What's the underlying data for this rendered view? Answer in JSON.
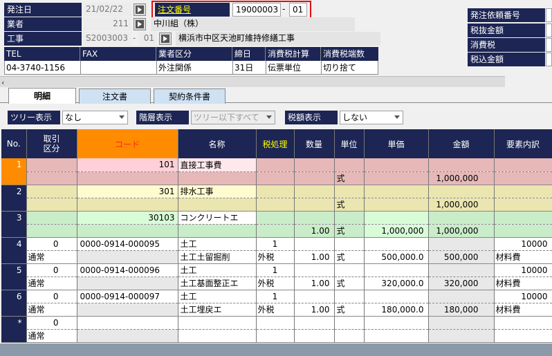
{
  "header": {
    "order_date_label": "発注日",
    "order_date": "21/02/22",
    "order_no_label": "注文番号",
    "order_no": "19000003",
    "order_sep": "-",
    "order_branch": "01",
    "vendor_label": "業者",
    "vendor_code": "211",
    "vendor_name": "中川組（株）",
    "project_label": "工事",
    "project_code": "S2003003",
    "project_sep": "-",
    "project_branch": "01",
    "project_name": "横浜市中区天池町維持修繕工事"
  },
  "info_table": {
    "headers": [
      "TEL",
      "FAX",
      "業者区分",
      "締日",
      "消費税計算",
      "消費税端数"
    ],
    "values": [
      "04-3740-1156",
      "",
      "外注関係",
      "31日",
      "伝票単位",
      "切り捨て"
    ]
  },
  "right_panel": {
    "labels": [
      "発注依頼番号",
      "税抜金額",
      "消費税",
      "税込金額"
    ]
  },
  "tabs": [
    "明細",
    "注文書",
    "契約条件書"
  ],
  "filters": {
    "tree_label": "ツリー表示",
    "tree_value": "なし",
    "level_label": "階層表示",
    "level_value": "ツリー以下すべて",
    "tax_label": "税額表示",
    "tax_value": "しない"
  },
  "grid": {
    "columns": [
      "No.",
      "取引\n区分",
      "コード",
      "名称",
      "税処理",
      "数量",
      "単位",
      "単価",
      "金額",
      "要素内訳"
    ],
    "rows": [
      {
        "no": "1",
        "a1": "",
        "a2": "",
        "code": "101",
        "name1": "直接工事費",
        "name2": "",
        "tax1": "",
        "tax2": "",
        "qty": "",
        "unit": "式",
        "price": "",
        "amount": "1,000,000",
        "el1": "",
        "el2": ""
      },
      {
        "no": "2",
        "a1": "",
        "a2": "",
        "code": "301",
        "name1": "排水工事",
        "name2": "",
        "tax1": "",
        "tax2": "",
        "qty": "",
        "unit": "式",
        "price": "",
        "amount": "1,000,000",
        "el1": "",
        "el2": ""
      },
      {
        "no": "3",
        "a1": "",
        "a2": "",
        "code": "30103",
        "name1": "コンクリートエ",
        "name2": "",
        "tax1": "",
        "tax2": "",
        "qty": "1.00",
        "unit": "式",
        "price": "1,000,000",
        "amount": "1,000,000",
        "el1": "",
        "el2": ""
      },
      {
        "no": "4",
        "a1": "0",
        "a2": "通常",
        "code": "0000-0914-000095",
        "name1": "土工",
        "name2": "土工土留掘削",
        "tax1": "1",
        "tax2": "外税",
        "qty": "1.00",
        "unit": "式",
        "price": "500,000.0",
        "amount": "500,000",
        "el1": "10000",
        "el2": "材料費"
      },
      {
        "no": "5",
        "a1": "0",
        "a2": "通常",
        "code": "0000-0914-000096",
        "name1": "土工",
        "name2": "土工基面整正エ",
        "tax1": "1",
        "tax2": "外税",
        "qty": "1.00",
        "unit": "式",
        "price": "320,000.0",
        "amount": "320,000",
        "el1": "10000",
        "el2": "材料費"
      },
      {
        "no": "6",
        "a1": "0",
        "a2": "通常",
        "code": "0000-0914-000097",
        "name1": "土工",
        "name2": "土工埋戻エ",
        "tax1": "1",
        "tax2": "外税",
        "qty": "1.00",
        "unit": "式",
        "price": "180,000.0",
        "amount": "180,000",
        "el1": "10000",
        "el2": "材料費"
      },
      {
        "no": "*",
        "a1": "0",
        "a2": "通常",
        "code": "",
        "name1": "",
        "name2": "",
        "tax1": "",
        "tax2": "",
        "qty": "",
        "unit": "",
        "price": "",
        "amount": "",
        "el1": "",
        "el2": ""
      }
    ]
  },
  "colors": {
    "navy": "#1c2553",
    "highlight_orange": "#ff8c00",
    "row1_bg": "#e6b8b8",
    "row2_bg": "#ebe6b0",
    "row3_bg": "#c9ecc9"
  }
}
